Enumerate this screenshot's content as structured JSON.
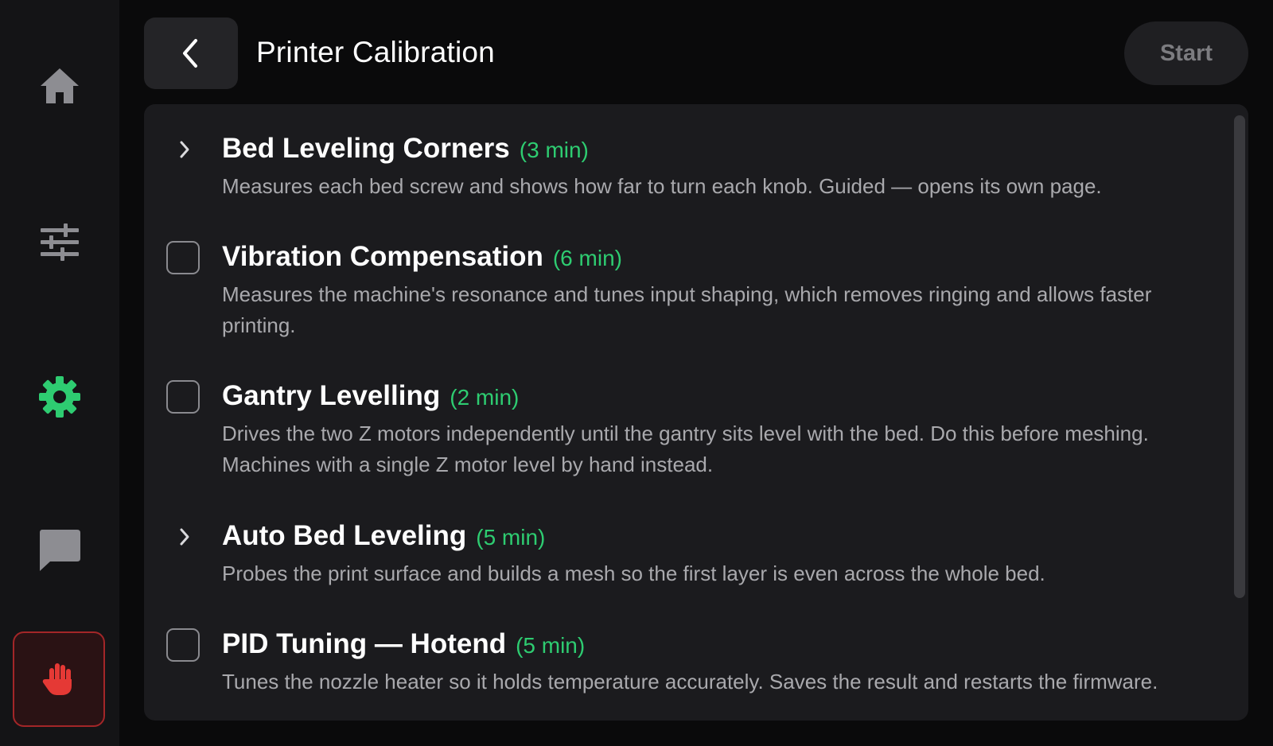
{
  "colors": {
    "background": "#0a0a0b",
    "sidebar": "#141416",
    "panel": "#1b1b1e",
    "accent": "#2ecc71",
    "estop": "#e53935",
    "estop_border": "#a32628"
  },
  "sidebar": {
    "items": [
      {
        "icon": "home-icon",
        "active": false
      },
      {
        "icon": "sliders-icon",
        "active": false
      },
      {
        "icon": "gear-icon",
        "active": true
      },
      {
        "icon": "chat-icon",
        "active": false
      }
    ],
    "estop_icon": "hand-stop-icon"
  },
  "header": {
    "back_icon": "chevron-left-icon",
    "title": "Printer Calibration",
    "start_label": "Start"
  },
  "items": [
    {
      "control": "expand",
      "title": "Bed Leveling Corners",
      "duration": "(3 min)",
      "description": "Measures each bed screw and shows how far to turn each knob. Guided — opens its own page."
    },
    {
      "control": "checkbox",
      "checked": false,
      "title": "Vibration Compensation",
      "duration": "(6 min)",
      "description": "Measures the machine's resonance and tunes input shaping, which removes ringing and allows faster printing."
    },
    {
      "control": "checkbox",
      "checked": false,
      "title": "Gantry Levelling",
      "duration": "(2 min)",
      "description": "Drives the two Z motors independently until the gantry sits level with the bed. Do this before meshing. Machines with a single Z motor level by hand instead."
    },
    {
      "control": "expand",
      "title": "Auto Bed Leveling",
      "duration": "(5 min)",
      "description": "Probes the print surface and builds a mesh so the first layer is even across the whole bed."
    },
    {
      "control": "checkbox",
      "checked": false,
      "title": "PID Tuning — Hotend",
      "duration": "(5 min)",
      "description": "Tunes the nozzle heater so it holds temperature accurately. Saves the result and restarts the firmware."
    }
  ]
}
